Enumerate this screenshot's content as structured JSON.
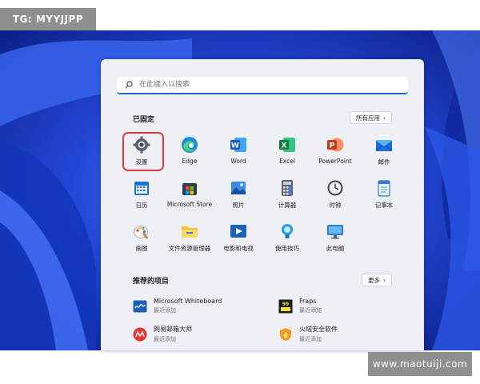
{
  "watermarks": {
    "top_left": "TG: MYYJJPP",
    "bottom_right": "www.maotuiji.com"
  },
  "search": {
    "placeholder": "在此键入以搜索"
  },
  "pinned": {
    "title": "已固定",
    "all_apps_label": "所有应用",
    "apps": [
      {
        "label": "设置",
        "icon": "gear-icon"
      },
      {
        "label": "Edge",
        "icon": "edge-icon"
      },
      {
        "label": "Word",
        "icon": "word-icon"
      },
      {
        "label": "Excel",
        "icon": "excel-icon"
      },
      {
        "label": "PowerPoint",
        "icon": "powerpoint-icon"
      },
      {
        "label": "邮件",
        "icon": "mail-icon"
      },
      {
        "label": "日历",
        "icon": "calendar-icon"
      },
      {
        "label": "Microsoft Store",
        "icon": "store-icon"
      },
      {
        "label": "照片",
        "icon": "photos-icon"
      },
      {
        "label": "计算器",
        "icon": "calculator-icon"
      },
      {
        "label": "时钟",
        "icon": "clock-icon"
      },
      {
        "label": "记事本",
        "icon": "notepad-icon"
      },
      {
        "label": "画图",
        "icon": "paint-icon"
      },
      {
        "label": "文件资源管理器",
        "icon": "folder-icon"
      },
      {
        "label": "电影和电视",
        "icon": "movies-icon"
      },
      {
        "label": "使用技巧",
        "icon": "tips-icon"
      },
      {
        "label": "此电脑",
        "icon": "computer-icon"
      }
    ]
  },
  "recommended": {
    "title": "推荐的项目",
    "more_label": "更多",
    "items": [
      {
        "title": "Microsoft Whiteboard",
        "subtitle": "最近添加",
        "icon": "whiteboard-icon"
      },
      {
        "title": "Fraps",
        "subtitle": "最近添加",
        "icon": "fraps-icon"
      },
      {
        "title": "网易邮箱大师",
        "subtitle": "最近添加",
        "icon": "netease-mail-icon"
      },
      {
        "title": "火绒安全软件",
        "subtitle": "最近添加",
        "icon": "huorong-icon"
      }
    ]
  }
}
